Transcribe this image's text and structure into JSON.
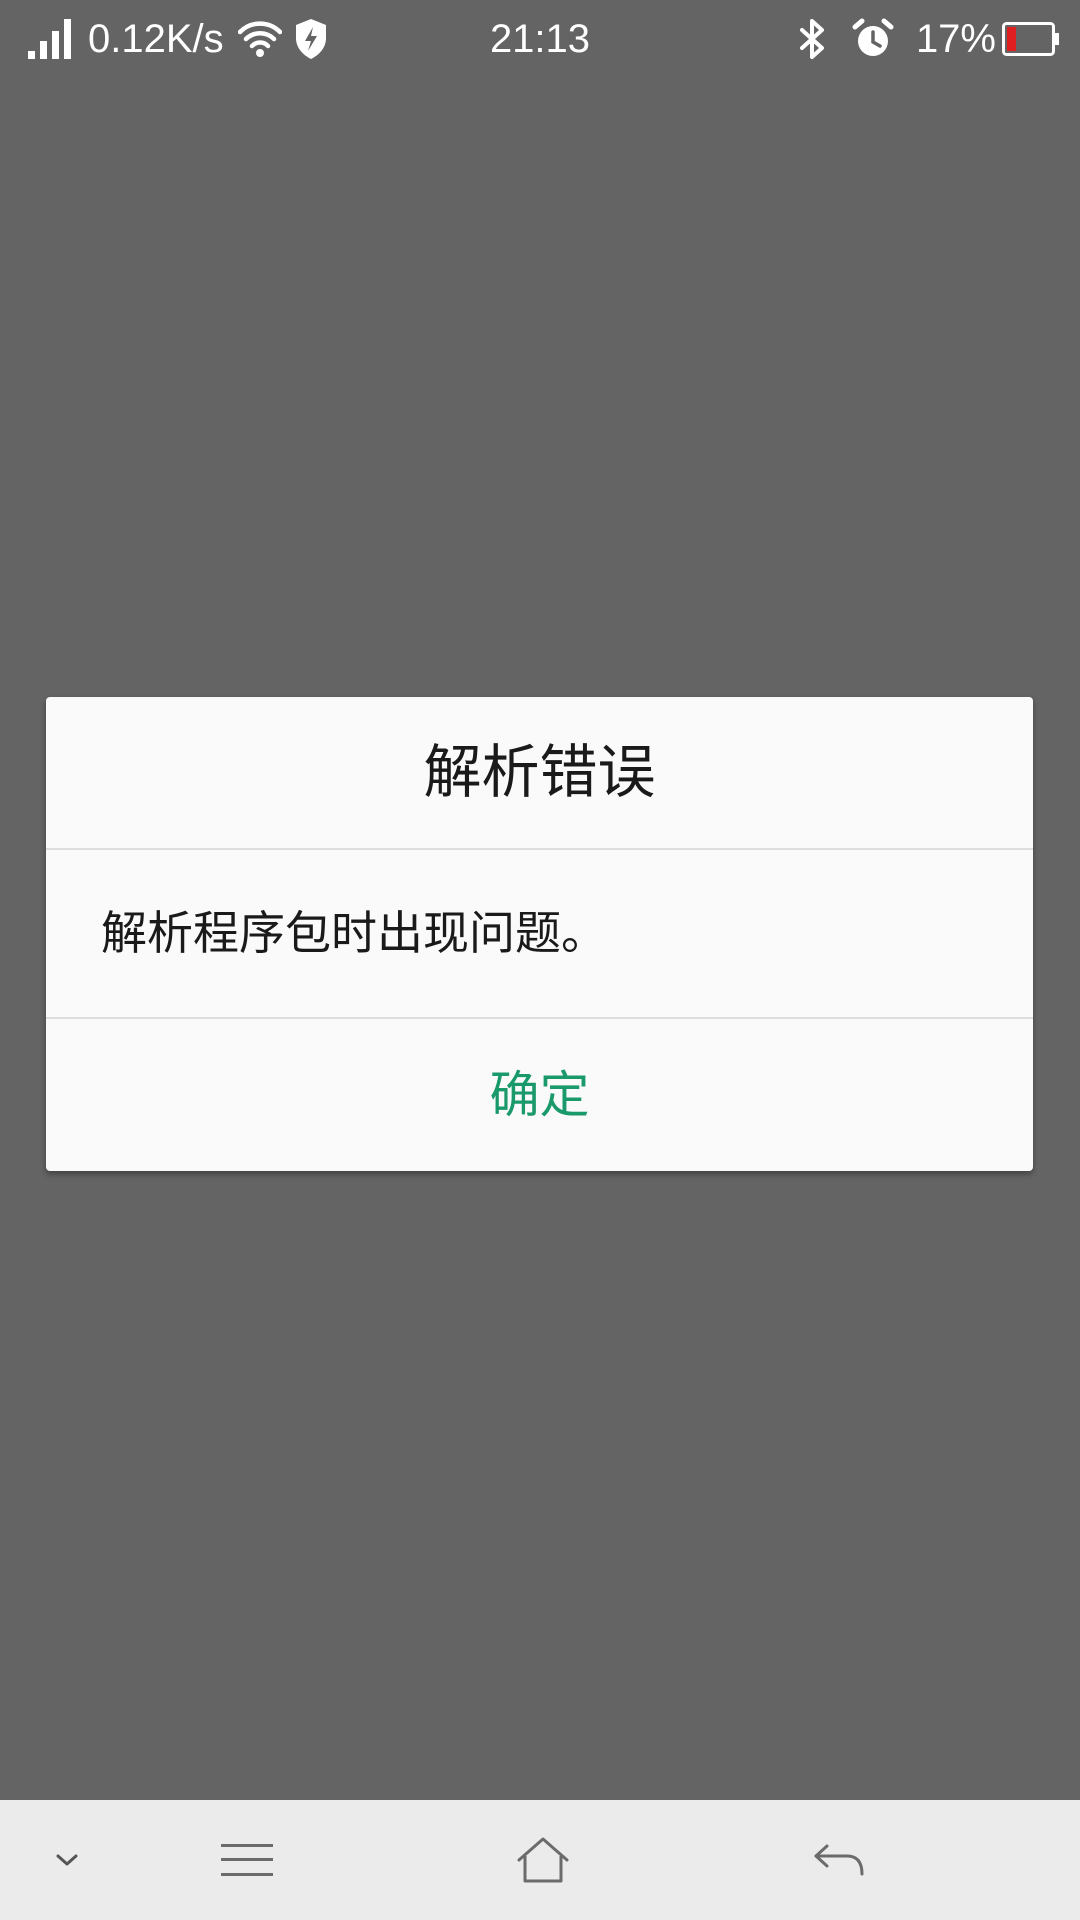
{
  "status_bar": {
    "network_speed": "0.12K/s",
    "time": "21:13",
    "battery_percent": "17%",
    "icons": [
      "signal-icon",
      "wifi-icon",
      "shield-icon",
      "bluetooth-icon",
      "alarm-icon",
      "battery-icon"
    ],
    "battery_level": 0.17,
    "battery_color": "#e02020"
  },
  "dialog": {
    "title": "解析错误",
    "message": "解析程序包时出现问题。",
    "confirm_label": "确定",
    "accent_color": "#1a9a6a"
  },
  "nav_bar": {
    "icons": [
      "chevron-down-icon",
      "menu-icon",
      "home-icon",
      "back-icon"
    ]
  }
}
